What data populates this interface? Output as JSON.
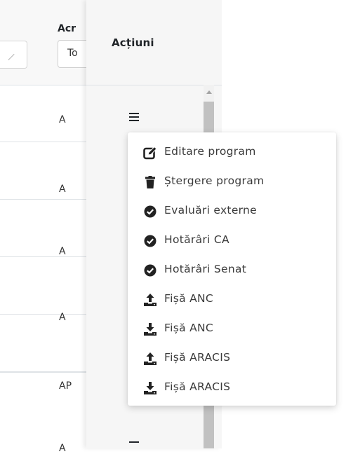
{
  "table": {
    "columns": {
      "acronym": {
        "label": "Acr",
        "filter_value": "To"
      },
      "actions": {
        "label": "Acțiuni"
      }
    },
    "rows": [
      {
        "value": "A"
      },
      {
        "value": "A"
      },
      {
        "value": "A"
      },
      {
        "value": "A"
      },
      {
        "value": "AP"
      },
      {
        "value": "A"
      }
    ]
  },
  "action_menu": {
    "items": [
      {
        "label": "Editare program",
        "icon": "edit-icon"
      },
      {
        "label": "Ștergere program",
        "icon": "trash-icon"
      },
      {
        "label": "Evaluări externe",
        "icon": "check-circle-icon"
      },
      {
        "label": "Hotărâri CA",
        "icon": "check-circle-icon"
      },
      {
        "label": "Hotărâri Senat",
        "icon": "check-circle-icon"
      },
      {
        "label": "Fișă ANC",
        "icon": "upload-icon"
      },
      {
        "label": "Fișă ANC",
        "icon": "download-icon"
      },
      {
        "label": "Fișă ARACIS",
        "icon": "upload-icon"
      },
      {
        "label": "Fișă ARACIS",
        "icon": "download-icon"
      }
    ]
  }
}
